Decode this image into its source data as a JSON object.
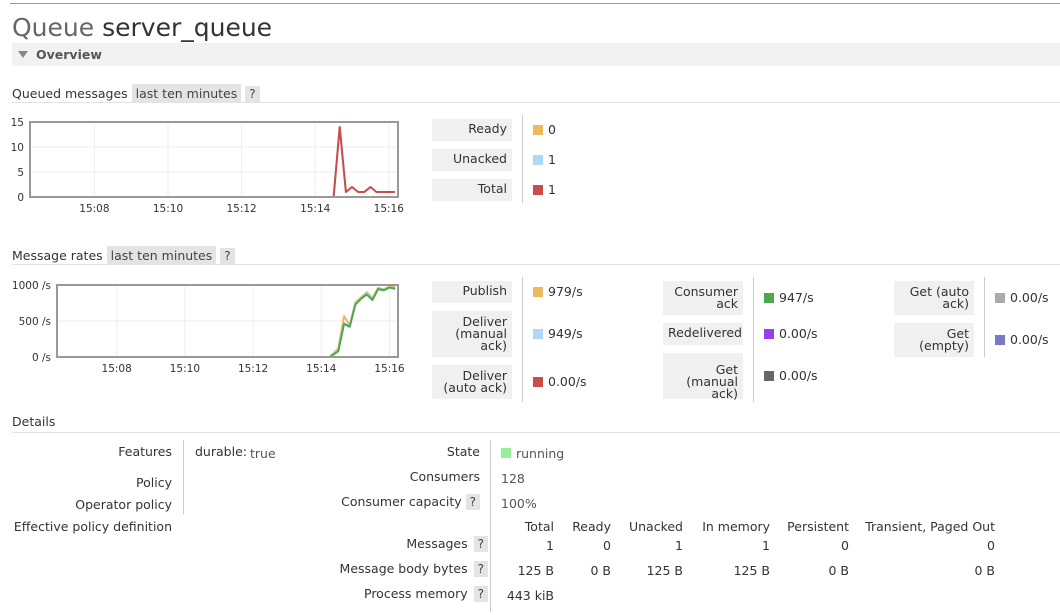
{
  "page": {
    "title_prefix": "Queue",
    "title_name": "server_queue"
  },
  "overview": {
    "label": "Overview"
  },
  "queued": {
    "heading": "Queued messages",
    "range": "last ten minutes",
    "help": "?",
    "legend": [
      {
        "label": "Ready",
        "value": "0",
        "color": "#edb95e"
      },
      {
        "label": "Unacked",
        "value": "1",
        "color": "#afd8f8"
      },
      {
        "label": "Total",
        "value": "1",
        "color": "#cb4b4b"
      }
    ]
  },
  "rates": {
    "heading": "Message rates",
    "range": "last ten minutes",
    "help": "?",
    "col1": [
      {
        "label": "Publish",
        "value": "979/s",
        "color": "#edb95e"
      },
      {
        "label": "Deliver (manual ack)",
        "value": "949/s",
        "color": "#afd8f8"
      },
      {
        "label": "Deliver (auto ack)",
        "value": "0.00/s",
        "color": "#cb4b4b"
      }
    ],
    "col2": [
      {
        "label": "Consumer ack",
        "value": "947/s",
        "color": "#4da74d"
      },
      {
        "label": "Redelivered",
        "value": "0.00/s",
        "color": "#9440ed"
      },
      {
        "label": "Get (manual ack)",
        "value": "0.00/s",
        "color": "#666666"
      }
    ],
    "col3": [
      {
        "label": "Get (auto ack)",
        "value": "0.00/s",
        "color": "#aaaaaa"
      },
      {
        "label": "Get (empty)",
        "value": "0.00/s",
        "color": "#7c79c3"
      }
    ]
  },
  "details": {
    "heading": "Details",
    "features_label": "Features",
    "features_key": "durable:",
    "features_value": "true",
    "policy_label": "Policy",
    "operator_policy_label": "Operator policy",
    "effective_policy_label": "Effective policy definition",
    "state_label": "State",
    "state_value": "running",
    "state_color": "#99ee99",
    "consumers_label": "Consumers",
    "consumers_value": "128",
    "capacity_label": "Consumer capacity",
    "capacity_value": "100%",
    "help": "?",
    "table": {
      "headers": [
        "Total",
        "Ready",
        "Unacked",
        "In memory",
        "Persistent",
        "Transient, Paged Out"
      ],
      "rows": [
        {
          "label": "Messages",
          "values": [
            "1",
            "0",
            "1",
            "1",
            "0",
            "0"
          ]
        },
        {
          "label": "Message body bytes",
          "values": [
            "125 B",
            "0 B",
            "125 B",
            "125 B",
            "0 B",
            "0 B"
          ]
        },
        {
          "label": "Process memory",
          "values": [
            "443 kiB"
          ]
        }
      ]
    }
  },
  "chart_data": [
    {
      "type": "line",
      "xlabel": "",
      "ylabel": "",
      "xticks": [
        "15:08",
        "15:10",
        "15:12",
        "15:14",
        "15:16"
      ],
      "yticks": [
        "0",
        "5",
        "10",
        "15"
      ],
      "ylim": [
        0,
        15
      ],
      "x": [
        "15:06:15",
        "15:07",
        "15:08",
        "15:09",
        "15:10",
        "15:11",
        "15:12",
        "15:13",
        "15:14",
        "15:14:30",
        "15:14:40",
        "15:14:50",
        "15:15:00",
        "15:15:10",
        "15:15:20",
        "15:15:30",
        "15:15:40",
        "15:15:50",
        "15:16:00",
        "15:16:10"
      ],
      "series": [
        {
          "name": "Ready",
          "color": "#edb95e",
          "values": [
            0,
            0,
            0,
            0,
            0,
            0,
            0,
            0,
            0,
            0,
            0,
            0,
            0,
            0,
            0,
            0,
            0,
            0,
            0,
            0
          ]
        },
        {
          "name": "Unacked",
          "color": "#afd8f8",
          "values": [
            0,
            0,
            0,
            0,
            0,
            0,
            0,
            0,
            0,
            0,
            14,
            1,
            2,
            1,
            1,
            2,
            1,
            1,
            1,
            1
          ]
        },
        {
          "name": "Total",
          "color": "#cb4b4b",
          "values": [
            0,
            0,
            0,
            0,
            0,
            0,
            0,
            0,
            0,
            0,
            14,
            1,
            2,
            1,
            1,
            2,
            1,
            1,
            1,
            1
          ]
        }
      ]
    },
    {
      "type": "line",
      "xlabel": "",
      "ylabel": "",
      "xticks": [
        "15:08",
        "15:10",
        "15:12",
        "15:14",
        "15:16"
      ],
      "yticks": [
        "0 /s",
        "500 /s",
        "1000 /s"
      ],
      "ylim": [
        0,
        1000
      ],
      "x": [
        "15:06:15",
        "15:07",
        "15:08",
        "15:09",
        "15:10",
        "15:11",
        "15:12",
        "15:13",
        "15:14",
        "15:14:15",
        "15:14:30",
        "15:14:40",
        "15:14:50",
        "15:15:00",
        "15:15:10",
        "15:15:20",
        "15:15:30",
        "15:15:40",
        "15:15:50",
        "15:16:00",
        "15:16:10"
      ],
      "series": [
        {
          "name": "Publish",
          "color": "#edb95e",
          "values": [
            0,
            0,
            0,
            0,
            0,
            0,
            0,
            0,
            0,
            0,
            120,
            570,
            440,
            760,
            830,
            900,
            820,
            960,
            940,
            980,
            979
          ]
        },
        {
          "name": "Deliver (manual ack)",
          "color": "#afd8f8",
          "values": [
            0,
            0,
            0,
            0,
            0,
            0,
            0,
            0,
            0,
            0,
            90,
            470,
            430,
            740,
            820,
            880,
            800,
            950,
            930,
            970,
            949
          ]
        },
        {
          "name": "Consumer ack",
          "color": "#4da74d",
          "values": [
            0,
            0,
            0,
            0,
            0,
            0,
            0,
            0,
            0,
            0,
            80,
            460,
            420,
            730,
            810,
            870,
            790,
            945,
            925,
            965,
            947
          ]
        }
      ]
    }
  ]
}
